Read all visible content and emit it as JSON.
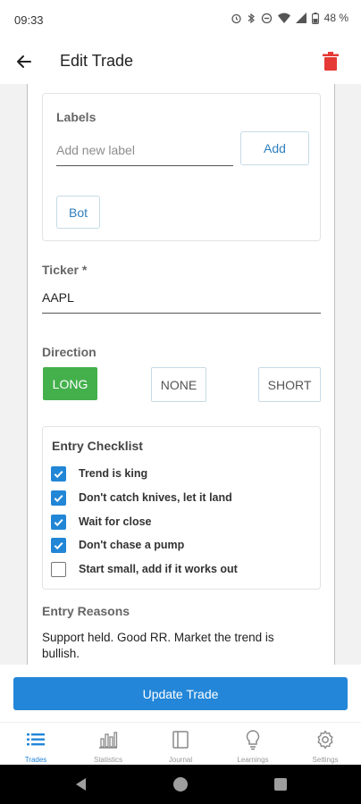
{
  "status_bar": {
    "time": "09:33",
    "battery": "48 %"
  },
  "app_bar": {
    "title": "Edit Trade"
  },
  "labels": {
    "title": "Labels",
    "input_placeholder": "Add new label",
    "add_button": "Add",
    "chips": [
      "Bot"
    ]
  },
  "ticker": {
    "label": "Ticker *",
    "value": "AAPL"
  },
  "direction": {
    "label": "Direction",
    "options": [
      "LONG",
      "NONE",
      "SHORT"
    ],
    "selected": "LONG"
  },
  "checklist": {
    "title": "Entry Checklist",
    "items": [
      {
        "label": "Trend is king",
        "checked": true
      },
      {
        "label": "Don't catch knives, let it land",
        "checked": true
      },
      {
        "label": "Wait for close",
        "checked": true
      },
      {
        "label": "Don't chase a pump",
        "checked": true
      },
      {
        "label": "Start small, add if it works out",
        "checked": false
      }
    ]
  },
  "entry_reasons": {
    "label": "Entry Reasons",
    "value": "Support held. Good RR. Market the trend is bullish."
  },
  "update_button": "Update Trade",
  "bottom_nav": {
    "items": [
      {
        "label": "Trades",
        "icon": "list-icon",
        "active": true
      },
      {
        "label": "Statistics",
        "icon": "bar-chart-icon",
        "active": false
      },
      {
        "label": "Journal",
        "icon": "journal-icon",
        "active": false
      },
      {
        "label": "Learnings",
        "icon": "lightbulb-icon",
        "active": false
      },
      {
        "label": "Settings",
        "icon": "gear-icon",
        "active": false
      }
    ]
  },
  "colors": {
    "primary": "#2386d8",
    "long_green": "#44b04c",
    "delete_red": "#e53935"
  }
}
